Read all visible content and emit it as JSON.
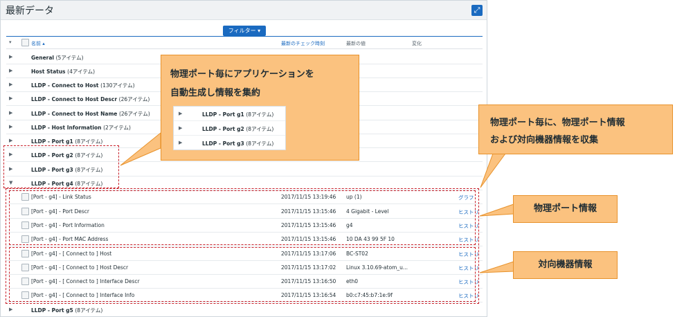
{
  "panel": {
    "title": "最新データ",
    "filter_label": "フィルター ▾"
  },
  "table": {
    "headers": {
      "name": "名前 ▴",
      "last_check": "最新のチェック時刻",
      "last_value": "最新の値",
      "change": "変化"
    },
    "groups_top": [
      {
        "name": "General",
        "count": "(5アイテム)"
      },
      {
        "name": "Host Status",
        "count": "(4アイテム)"
      },
      {
        "name": "LLDP - Connect to Host",
        "count": "(130アイテム)"
      },
      {
        "name": "LLDP - Connect to Host Descr",
        "count": "(26アイテム)"
      },
      {
        "name": "LLDP - Connect to Host Name",
        "count": "(26アイテム)"
      },
      {
        "name": "LLDP - Host Information",
        "count": "(2アイテム)"
      },
      {
        "name": "LLDP - Port g1",
        "count": "(8アイテム)"
      },
      {
        "name": "LLDP - Port g2",
        "count": "(8アイテム)"
      },
      {
        "name": "LLDP - Port g3",
        "count": "(8アイテム)"
      },
      {
        "name": "LLDP - Port g4",
        "count": "(8アイテム)"
      }
    ],
    "items": [
      {
        "name": "[Port - g4] - Link Status",
        "time": "2017/11/15 13:19:46",
        "value": "up (1)",
        "link": "グラフ"
      },
      {
        "name": "[Port - g4] - Port Descr",
        "time": "2017/11/15 13:15:46",
        "value": "4 Gigabit - Level",
        "link": "ヒストリ"
      },
      {
        "name": "[Port - g4] - Port Information",
        "time": "2017/11/15 13:15:46",
        "value": "g4",
        "link": "ヒストリ"
      },
      {
        "name": "[Port - g4] - Port MAC Address",
        "time": "2017/11/15 13:15:46",
        "value": "10 DA 43 99 5F 10",
        "link": "ヒストリ"
      },
      {
        "name": "[Port - g4] - [ Connect to ] Host",
        "time": "2017/11/15 13:17:06",
        "value": "BC-ST02",
        "link": "ヒストリ"
      },
      {
        "name": "[Port - g4] - [ Connect to ] Host Descr",
        "time": "2017/11/15 13:17:02",
        "value": "Linux 3.10.69-atom_u...",
        "link": "ヒストリ"
      },
      {
        "name": "[Port - g4] - [ Connect to ] Interface Descr",
        "time": "2017/11/15 13:16:50",
        "value": "eth0",
        "link": "ヒストリ"
      },
      {
        "name": "[Port - g4] - [ Connect to ] Interface Info",
        "time": "2017/11/15 13:16:54",
        "value": "b0:c7:45:b7:1e:9f",
        "link": "ヒストリ"
      }
    ],
    "group_bottom": {
      "name": "LLDP - Port g5",
      "count": "(8アイテム)"
    }
  },
  "callouts": {
    "main": {
      "line1": "物理ポート毎にアプリケーションを",
      "line2": "自動生成し情報を集約",
      "inner": [
        {
          "name": "LLDP - Port g1",
          "count": "(8アイテム)"
        },
        {
          "name": "LLDP - Port g2",
          "count": "(8アイテム)"
        },
        {
          "name": "LLDP - Port g3",
          "count": "(8アイテム)"
        }
      ]
    },
    "right": {
      "line1": "物理ポート毎に、物理ポート情報",
      "line2": "および対向機器情報を収集"
    },
    "port_info": "物理ポート情報",
    "peer_info": "対向機器情報"
  },
  "colors": {
    "accent_blue": "#1a6ac0",
    "callout_fill": "#fbc27f",
    "callout_border": "#e8922b",
    "dashed_red": "#c8202a"
  }
}
